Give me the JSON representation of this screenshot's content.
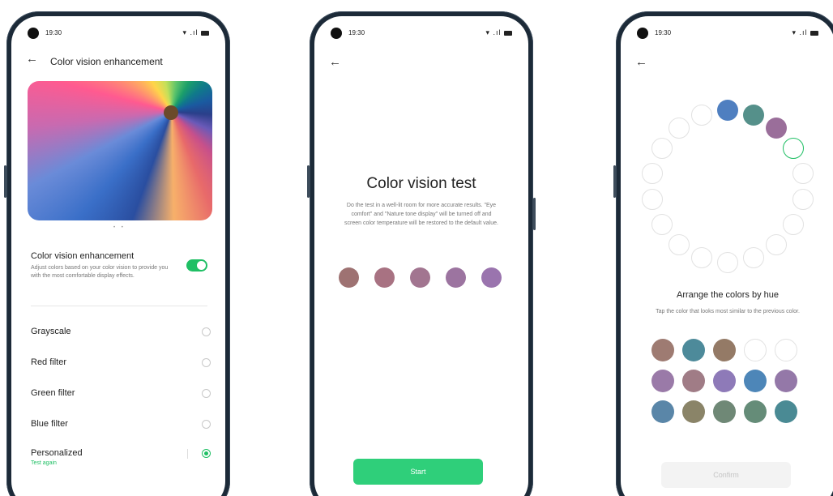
{
  "status_bar": {
    "time": "19:30",
    "icons": "wifi-signal-battery"
  },
  "screen1": {
    "title": "Color vision enhancement",
    "banner_pager": "• •",
    "enhancement": {
      "title": "Color vision enhancement",
      "description": "Adjust colors based on your color vision to provide you with the most comfortable display effects.",
      "toggle_on": true
    },
    "options": [
      {
        "label": "Grayscale",
        "selected": false
      },
      {
        "label": "Red filter",
        "selected": false
      },
      {
        "label": "Green filter",
        "selected": false
      },
      {
        "label": "Blue filter",
        "selected": false
      },
      {
        "label": "Personalized",
        "selected": true,
        "sub_label": "Test again"
      }
    ]
  },
  "screen2": {
    "title": "Color vision test",
    "description": "Do the test in a well-lit room for more accurate results. \"Eye comfort\" and \"Nature tone display\" will be turned off and screen color temperature will be restored to the default value.",
    "sample_colors": [
      "#9e7272",
      "#a87282",
      "#a27590",
      "#9c74a0",
      "#9a74ae"
    ],
    "start_label": "Start"
  },
  "screen3": {
    "ring_colors": [
      "#4f7fc0",
      "#55908a",
      "#9a6e9a",
      "selected",
      "empty",
      "empty",
      "empty",
      "empty",
      "empty",
      "empty",
      "empty",
      "empty",
      "empty",
      "empty",
      "empty",
      "empty",
      "empty",
      "empty"
    ],
    "title": "Arrange the colors by hue",
    "description": "Tap the color that looks most similar to the previous color.",
    "palette": [
      [
        "#9e7b72",
        "#4d8a9a",
        "#947a66",
        "empty",
        "empty"
      ],
      [
        "#9a7aa8",
        "#a07c86",
        "#8e7ab8",
        "#4d86b8",
        "#9478a8"
      ],
      [
        "#5a86a8",
        "#8a8468",
        "#6f8876",
        "#658c78",
        "#4a8a94"
      ]
    ],
    "confirm_label": "Confirm"
  }
}
